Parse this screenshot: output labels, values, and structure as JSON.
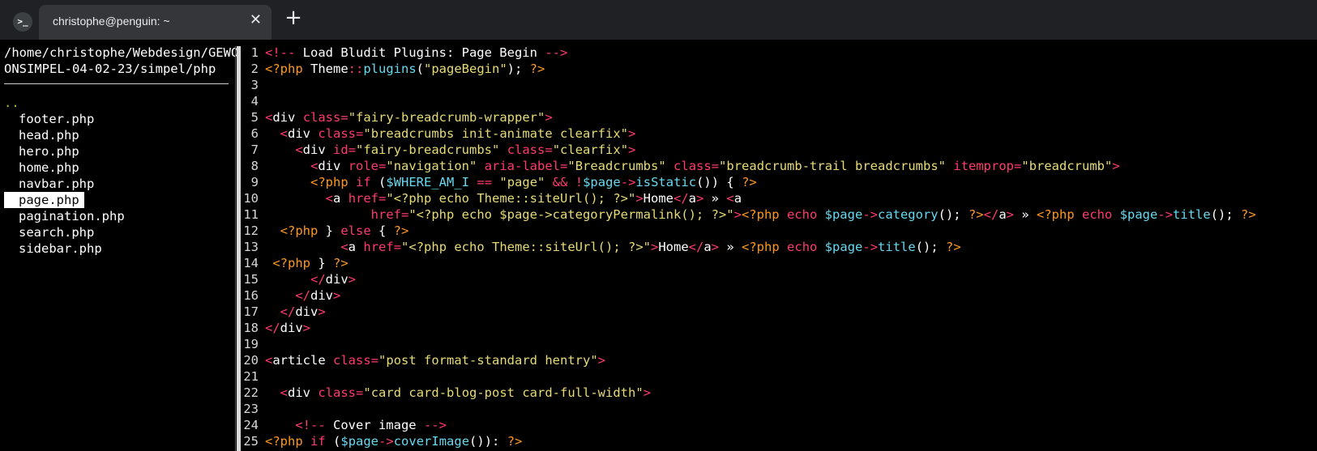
{
  "tabbar": {
    "icon": ">_",
    "tab_title": "christophe@penguin: ~",
    "close_symbol": "✕",
    "new_tab_symbol": "+"
  },
  "sidebar": {
    "path_line1": "/home/christophe/Webdesign/GEWO",
    "path_line2": "ONSIMPEL-04-02-23/simpel/php",
    "parent": "..",
    "files": [
      "footer.php",
      "head.php",
      "hero.php",
      "home.php",
      "navbar.php",
      "page.php",
      "pagination.php",
      "search.php",
      "sidebar.php"
    ],
    "selected_file": "page.php"
  },
  "editor": {
    "lines": [
      {
        "n": "1",
        "t": "<!-- Load Bludit Plugins: Page Begin -->"
      },
      {
        "n": "2",
        "t": "<?php Theme::plugins(\"pageBegin\"); ?>"
      },
      {
        "n": "3",
        "t": ""
      },
      {
        "n": "4",
        "t": ""
      },
      {
        "n": "5",
        "t": "<div class=\"fairy-breadcrumb-wrapper\">"
      },
      {
        "n": "6",
        "t": "  <div class=\"breadcrumbs init-animate clearfix\">"
      },
      {
        "n": "7",
        "t": "    <div id=\"fairy-breadcrumbs\" class=\"clearfix\">"
      },
      {
        "n": "8",
        "t": "      <div role=\"navigation\" aria-label=\"Breadcrumbs\" class=\"breadcrumb-trail breadcrumbs\" itemprop=\"breadcrumb\">"
      },
      {
        "n": "9",
        "t": "      <?php if ($WHERE_AM_I == \"page\" && !$page->isStatic()) { ?>"
      },
      {
        "n": "10",
        "t": "        <a href=\"<?php echo Theme::siteUrl(); ?>\">Home</a> » <a"
      },
      {
        "n": "11",
        "t": "              href=\"<?php echo $page->categoryPermalink(); ?>\"><?php echo $page->category(); ?></a> » <?php echo $page->title(); ?>"
      },
      {
        "n": "12",
        "t": "  <?php } else { ?>"
      },
      {
        "n": "13",
        "t": "          <a href=\"<?php echo Theme::siteUrl(); ?>\">Home</a> » <?php echo $page->title(); ?>"
      },
      {
        "n": "14",
        "t": " <?php } ?>"
      },
      {
        "n": "15",
        "t": "      </div>"
      },
      {
        "n": "16",
        "t": "    </div>"
      },
      {
        "n": "17",
        "t": "  </div>"
      },
      {
        "n": "18",
        "t": "</div>"
      },
      {
        "n": "19",
        "t": ""
      },
      {
        "n": "20",
        "t": "<article class=\"post format-standard hentry\">"
      },
      {
        "n": "21",
        "t": ""
      },
      {
        "n": "22",
        "t": "  <div class=\"card card-blog-post card-full-width\">"
      },
      {
        "n": "23",
        "t": ""
      },
      {
        "n": "24",
        "t": "    <!-- Cover image -->"
      },
      {
        "n": "25",
        "t": "<?php if ($page->coverImage()): ?>"
      }
    ]
  },
  "colors": {
    "background": "#000000",
    "tab_bg": "#35363a",
    "tabbar_bg": "#202124",
    "tag": "#ff3b6c",
    "string": "#e6db74",
    "function": "#66d9ef",
    "php": "#fd971f"
  }
}
